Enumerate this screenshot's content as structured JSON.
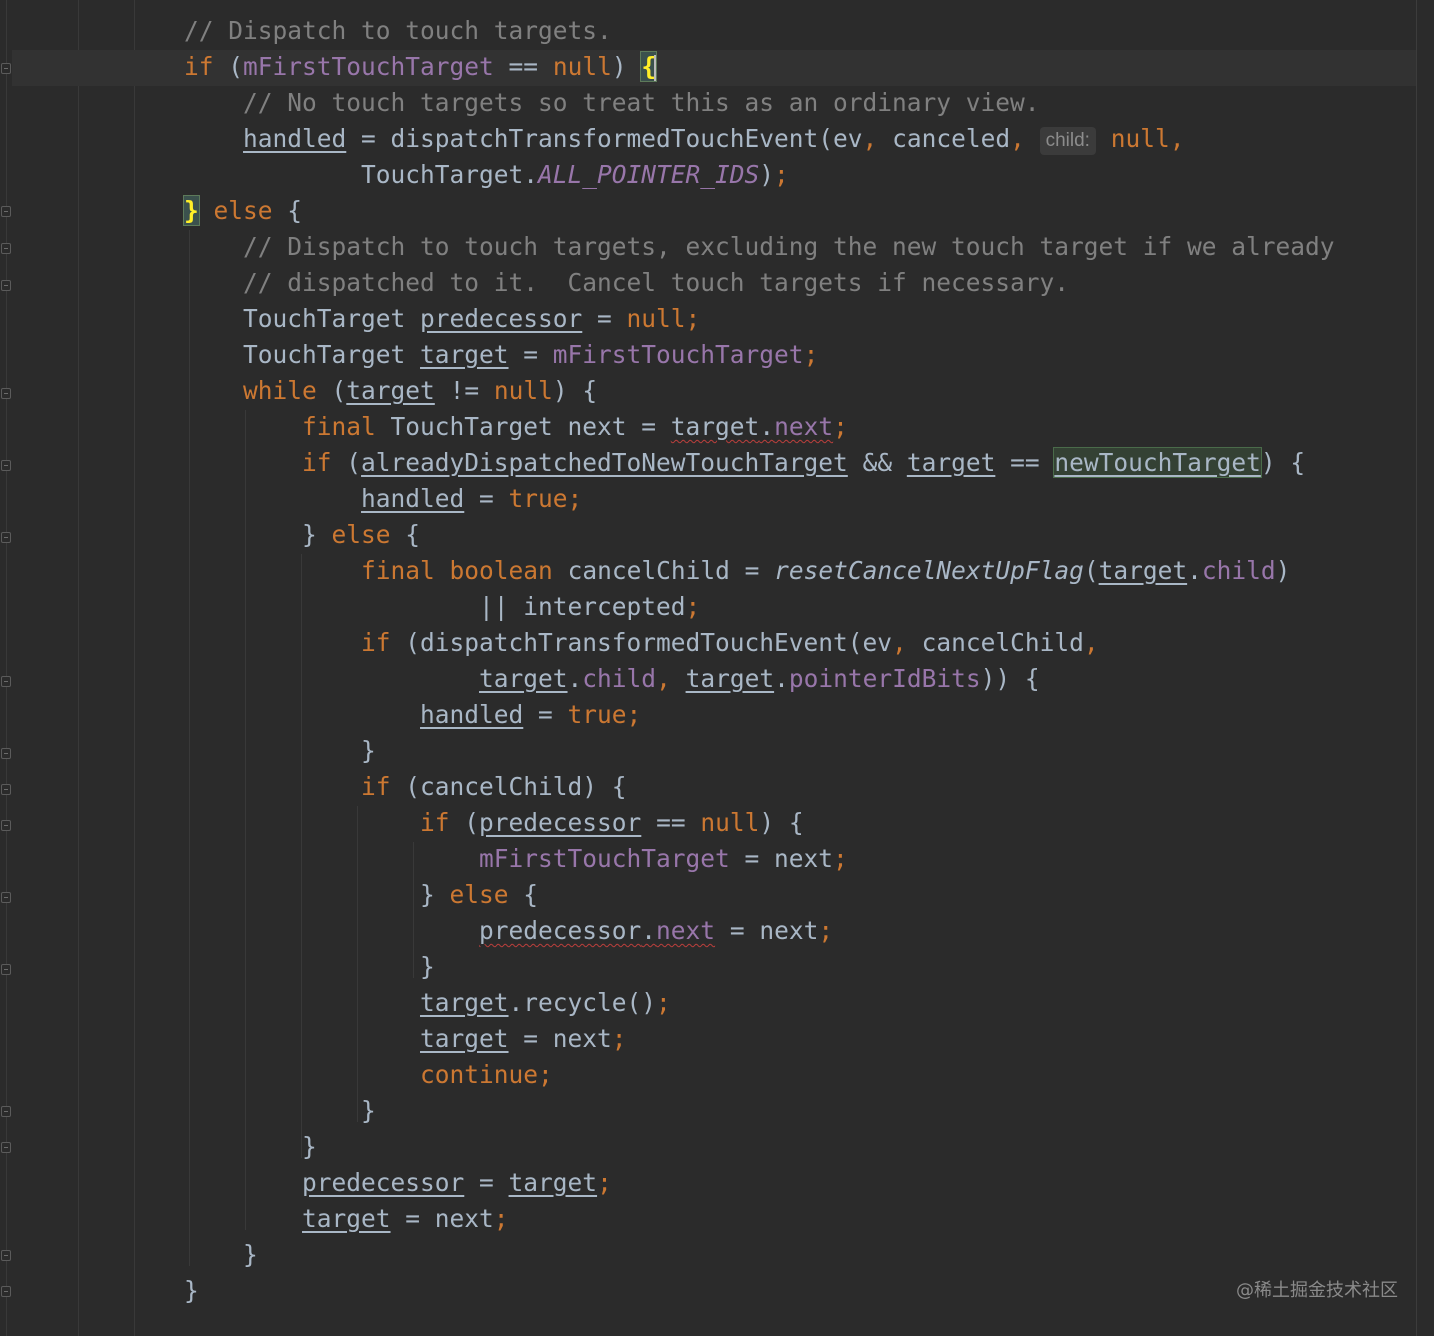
{
  "editor": {
    "line_1": {
      "t1": "// Dispatch to touch targets."
    },
    "line_2": {
      "t1": "if",
      "t2": " (",
      "t3": "mFirstTouchTarget",
      "t4": " == ",
      "t5": "null",
      "t6": ") ",
      "t7": "{"
    },
    "line_3": {
      "t1": "    // No touch targets so treat this as an ordinary view."
    },
    "line_4": {
      "t1": "    ",
      "t2": "handled",
      "t3": " = dispatchTransformedTouchEvent(ev",
      "t4": ", ",
      "t5": "canceled",
      "t6": ", ",
      "hint": "child:",
      "t7": " null,",
      "t8": ""
    },
    "line_5": {
      "t1": "            TouchTarget.",
      "t2": "ALL_POINTER_IDS",
      "t3": ")",
      "t4": ";"
    },
    "line_6": {
      "t1": "}",
      "t2": " ",
      "t3": "else",
      "t4": " {"
    },
    "line_7": {
      "t1": "    // Dispatch to touch targets, excluding the new touch target if we already"
    },
    "line_8": {
      "t1": "    // dispatched to it.  Cancel touch targets if necessary."
    },
    "line_9": {
      "t1": "    TouchTarget ",
      "t2": "predecessor",
      "t3": " = ",
      "t4": "null;"
    },
    "line_10": {
      "t1": "    TouchTarget ",
      "t2": "target",
      "t3": " = ",
      "t4": "mFirstTouchTarget",
      "t5": ";"
    },
    "line_11": {
      "t1": "    ",
      "t2": "while",
      "t3": " (",
      "t4": "target",
      "t5": " != ",
      "t6": "null",
      "t7": ") {"
    },
    "line_12": {
      "t1": "        ",
      "t2": "final",
      "t3": " TouchTarget next = ",
      "t4": "target",
      "t5": ".",
      "t6": "next",
      "t7": ";"
    },
    "line_13": {
      "t1": "        ",
      "t2": "if",
      "t3": " (",
      "t4": "alreadyDispatchedToNewTouchTarget",
      "t5": " && ",
      "t6": "target",
      "t7": " == ",
      "t8": "newTouchTarget",
      "t9": ") {"
    },
    "line_14": {
      "t1": "            ",
      "t2": "handled",
      "t3": " = ",
      "t4": "true;"
    },
    "line_15": {
      "t1": "        } ",
      "t2": "else",
      "t3": " {"
    },
    "line_16": {
      "t1": "            ",
      "t2": "final",
      "t3": " ",
      "t4": "boolean",
      "t5": " cancelChild = ",
      "t6": "resetCancelNextUpFlag",
      "t7": "(",
      "t8": "target",
      "t9": ".",
      "t10": "child",
      "t11": ")"
    },
    "line_17": {
      "t1": "                    || intercepted",
      "t2": ";"
    },
    "line_18": {
      "t1": "            ",
      "t2": "if",
      "t3": " (dispatchTransformedTouchEvent(ev",
      "t4": ", ",
      "t5": "cancelChild",
      "t6": ","
    },
    "line_19": {
      "t1": "                    ",
      "t2": "target",
      "t3": ".",
      "t4": "child",
      "t5": ", ",
      "t6": "target",
      "t7": ".",
      "t8": "pointerIdBits",
      "t9": ")) {"
    },
    "line_20": {
      "t1": "                ",
      "t2": "handled",
      "t3": " = ",
      "t4": "true;"
    },
    "line_21": {
      "t1": "            }"
    },
    "line_22": {
      "t1": "            ",
      "t2": "if",
      "t3": " (cancelChild) {"
    },
    "line_23": {
      "t1": "                ",
      "t2": "if",
      "t3": " (",
      "t4": "predecessor",
      "t5": " == ",
      "t6": "null",
      "t7": ") {"
    },
    "line_24": {
      "t1": "                    ",
      "t2": "mFirstTouchTarget",
      "t3": " = next",
      "t4": ";"
    },
    "line_25": {
      "t1": "                } ",
      "t2": "else",
      "t3": " {"
    },
    "line_26": {
      "t1": "                    ",
      "t2": "predecessor",
      "t3": ".",
      "t4": "next",
      "t5": " = next",
      "t6": ";"
    },
    "line_27": {
      "t1": "                }"
    },
    "line_28": {
      "t1": "                ",
      "t2": "target",
      "t3": ".recycle()",
      "t4": ";"
    },
    "line_29": {
      "t1": "                ",
      "t2": "target",
      "t3": " = next",
      "t4": ";"
    },
    "line_30": {
      "t1": "                ",
      "t2": "continue;"
    },
    "line_31": {
      "t1": "            }"
    },
    "line_32": {
      "t1": "        }"
    },
    "line_33": {
      "t1": "        ",
      "t2": "predecessor",
      "t3": " = ",
      "t4": "target",
      "t5": ";"
    },
    "line_34": {
      "t1": "        ",
      "t2": "target",
      "t3": " = next",
      "t4": ";"
    },
    "line_35": {
      "t1": "    }"
    },
    "line_36": {
      "t1": "}"
    }
  },
  "watermark": "@稀土掘金技术社区",
  "colors": {
    "background": "#2b2b2b",
    "default_text": "#a9b7c6",
    "keyword": "#cc7832",
    "comment": "#808080",
    "field": "#9876aa",
    "brace_match": "#ffef28"
  }
}
